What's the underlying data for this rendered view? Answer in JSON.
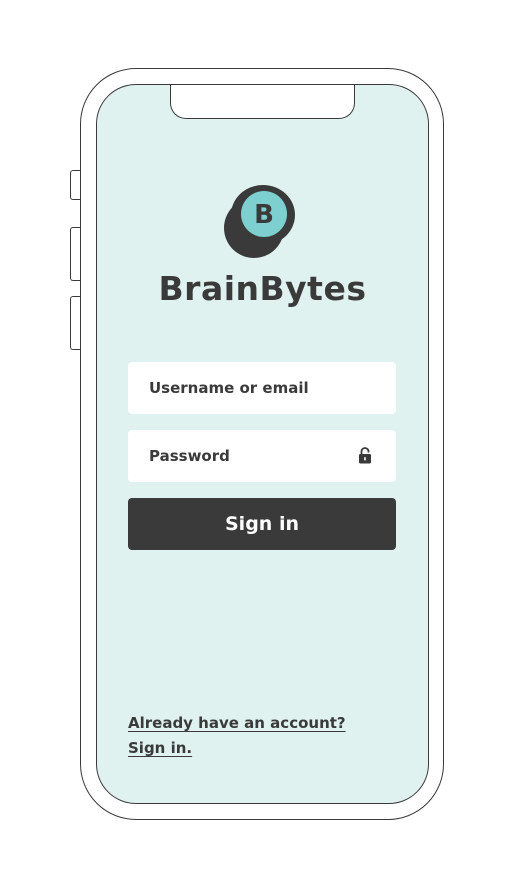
{
  "brand": {
    "name": "BrainBytes",
    "logo_letter": "B",
    "colors": {
      "accent": "#7ecfd0",
      "dark": "#3a3a3a",
      "screen_bg": "#dff2f0"
    }
  },
  "form": {
    "username_placeholder": "Username or email",
    "password_placeholder": "Password",
    "password_icon": "lock-icon",
    "signin_label": "Sign in"
  },
  "footer": {
    "prompt_line1": "Already have an account?",
    "prompt_line2": "Sign in."
  }
}
